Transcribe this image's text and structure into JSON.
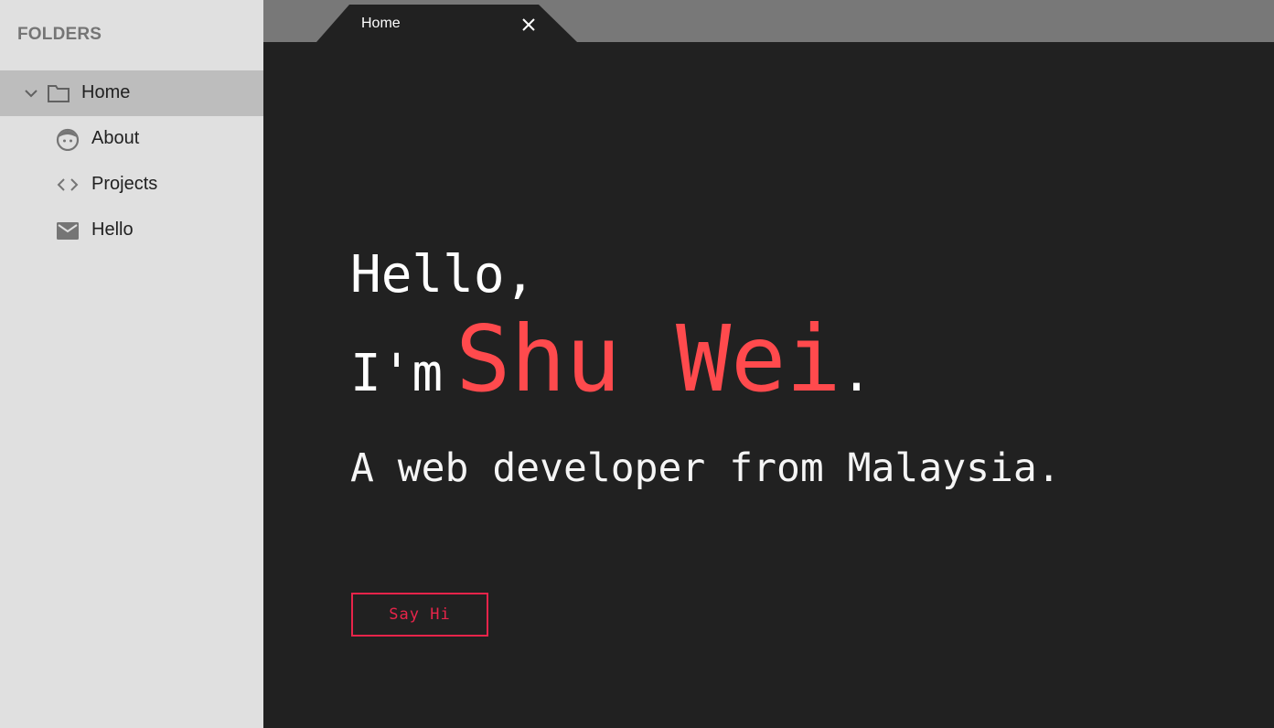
{
  "sidebar": {
    "heading": "FOLDERS",
    "root": {
      "label": "Home",
      "icon": "folder-icon",
      "expanded": true
    },
    "items": [
      {
        "label": "About",
        "icon": "face-icon"
      },
      {
        "label": "Projects",
        "icon": "code-icon"
      },
      {
        "label": "Hello",
        "icon": "mail-icon"
      }
    ]
  },
  "tab": {
    "label": "Home",
    "close_icon": "close-icon"
  },
  "hero": {
    "greeting": "Hello,",
    "im": "I'm",
    "name": "Shu Wei",
    "period": ".",
    "tagline": "A web developer from Malaysia.",
    "cta_label": "Say Hi"
  },
  "colors": {
    "sidebar_bg": "#e0e0e0",
    "sidebar_selected": "#bdbdbd",
    "tabbar_bg": "#787878",
    "content_bg": "#212121",
    "name_accent": "#ff4a4d",
    "cta_accent": "#e8244a"
  }
}
